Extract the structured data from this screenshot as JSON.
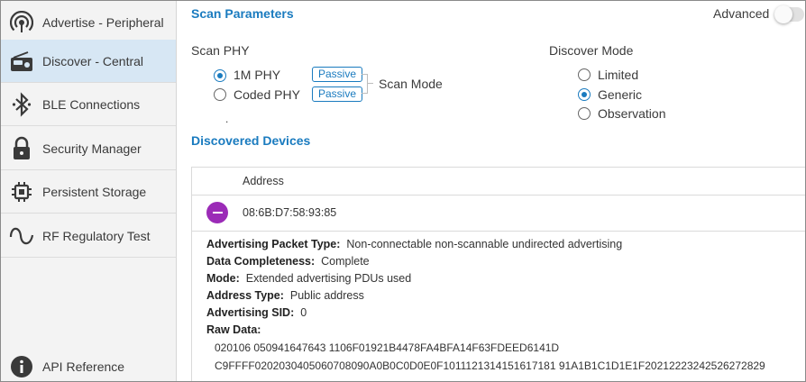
{
  "sidebar": {
    "items": [
      {
        "label": "Advertise - Peripheral",
        "icon": "broadcast-icon"
      },
      {
        "label": "Discover - Central",
        "icon": "radio-device-icon",
        "active": true
      },
      {
        "label": "BLE Connections",
        "icon": "bluetooth-icon"
      },
      {
        "label": "Security Manager",
        "icon": "lock-icon"
      },
      {
        "label": "Persistent Storage",
        "icon": "chip-icon"
      },
      {
        "label": "RF Regulatory Test",
        "icon": "sine-wave-icon"
      }
    ],
    "footer": {
      "label": "API Reference",
      "icon": "info-icon"
    }
  },
  "scan_parameters": {
    "title": "Scan Parameters",
    "advanced_label": "Advanced",
    "advanced_enabled": false,
    "scan_phy_label": "Scan PHY",
    "phy_options": [
      {
        "label": "1M PHY",
        "checked": true,
        "mode": "Passive"
      },
      {
        "label": "Coded PHY",
        "checked": false,
        "mode": "Passive"
      }
    ],
    "scan_mode_label": "Scan Mode",
    "dot": ".",
    "discover_mode_label": "Discover Mode",
    "discover_options": [
      {
        "label": "Limited",
        "checked": false
      },
      {
        "label": "Generic",
        "checked": true
      },
      {
        "label": "Observation",
        "checked": false
      }
    ]
  },
  "discovered": {
    "title": "Discovered Devices",
    "column_address": "Address",
    "device": {
      "address": "08:6B:D7:58:93:85",
      "details": [
        {
          "key": "Advertising Packet Type:",
          "value": "Non-connectable non-scannable undirected advertising"
        },
        {
          "key": "Data Completeness:",
          "value": "Complete"
        },
        {
          "key": "Mode:",
          "value": "Extended advertising PDUs used"
        },
        {
          "key": "Address Type:",
          "value": "Public address"
        },
        {
          "key": "Advertising SID:",
          "value": "0"
        }
      ],
      "raw_label": "Raw Data:",
      "raw_lines": [
        "020106 050941647643 1106F01921B4478FA4BFA14F63FDEED6141D",
        "C9FFFF0202030405060708090A0B0C0D0E0F1011121314151617181 91A1B1C1D1E1F20212223242526272829"
      ]
    }
  },
  "colors": {
    "accent": "#1a7bbf",
    "active_nav": "#d7e7f4",
    "collapse_button": "#9b2bb7"
  }
}
